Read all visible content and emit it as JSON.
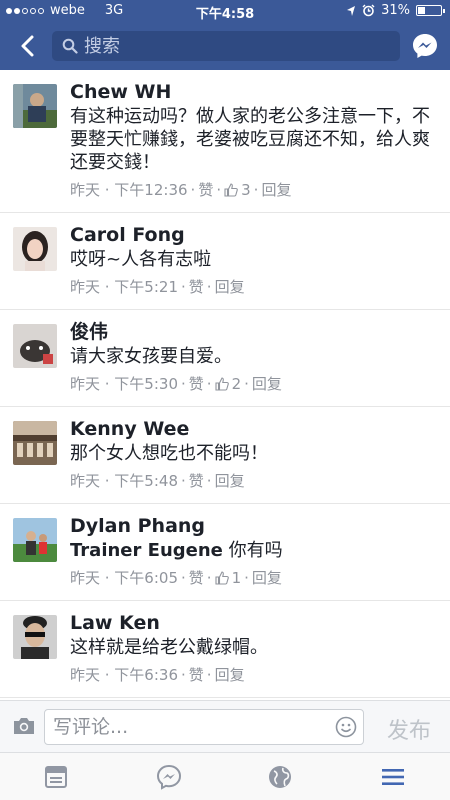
{
  "status_bar": {
    "carrier": "webe",
    "network": "3G",
    "time": "下午4:58",
    "battery": "31%",
    "battery_level": 0.31
  },
  "nav": {
    "search_placeholder": "搜索",
    "back_icon": "chevron-left-icon",
    "messenger_icon": "messenger-icon"
  },
  "comments": [
    {
      "name": "Chew WH",
      "text": "有这种运动吗？做人家的老公多注意一下，不要整天忙赚錢，老婆被吃豆腐还不知，给人爽还要交錢！",
      "time": "昨天 · 下午12:36",
      "like_label": "赞",
      "likes": "3",
      "reply_label": "回复"
    },
    {
      "name": "Carol Fong",
      "text": "哎呀~人各有志啦",
      "time": "昨天 · 下午5:21",
      "like_label": "赞",
      "likes": "",
      "reply_label": "回复"
    },
    {
      "name": "俊伟",
      "text": "请大家女孩要自爱。",
      "time": "昨天 · 下午5:30",
      "like_label": "赞",
      "likes": "2",
      "reply_label": "回复"
    },
    {
      "name": "Kenny Wee",
      "text": "那个女人想吃也不能吗！",
      "time": "昨天 · 下午5:48",
      "like_label": "赞",
      "likes": "",
      "reply_label": "回复"
    },
    {
      "name": "Dylan Phang",
      "mention": "Trainer Eugene",
      "text": "你有吗",
      "time": "昨天 · 下午6:05",
      "like_label": "赞",
      "likes": "1",
      "reply_label": "回复"
    },
    {
      "name": "Law Ken",
      "text": "这样就是给老公戴绿帽。",
      "time": "昨天 · 下午6:36",
      "like_label": "赞",
      "likes": "",
      "reply_label": "回复"
    }
  ],
  "composer": {
    "placeholder": "写评论...",
    "post_label": "发布"
  },
  "tabs": [
    "feed-icon",
    "messenger-icon",
    "globe-icon",
    "menu-icon"
  ],
  "colors": {
    "brand_blue": "#3b5998",
    "active_tab": "#4267b2",
    "inactive_tab": "#9197a3"
  }
}
